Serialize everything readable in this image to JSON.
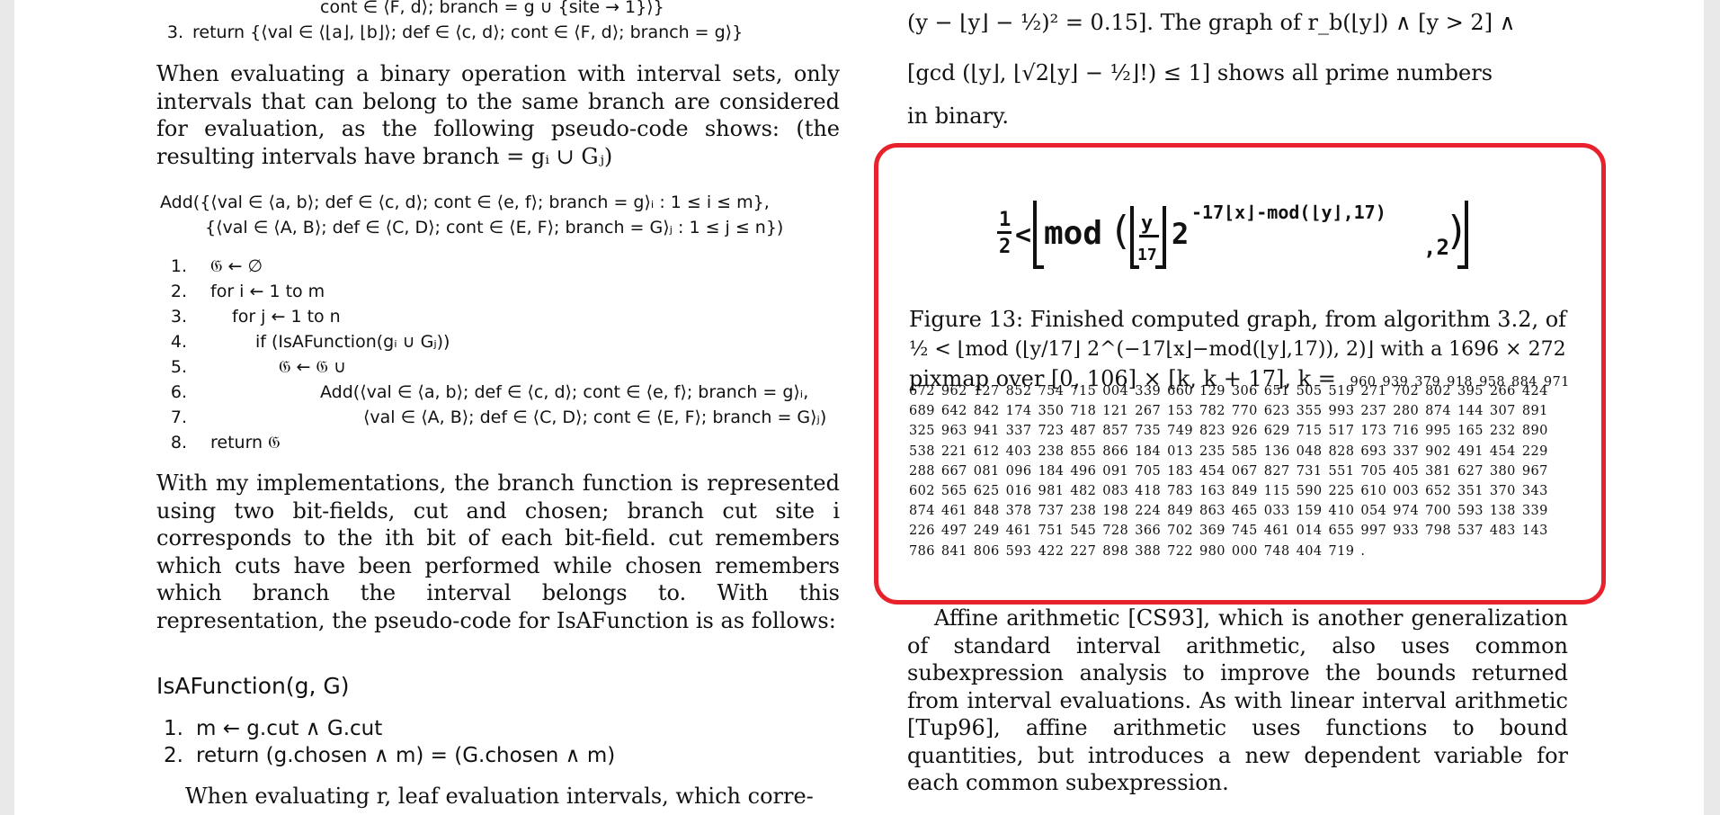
{
  "left": {
    "top_algo": {
      "line_prev": "cont ∈ ⟨F, d⟩; branch = g ∪ {site → 1}⟩}",
      "line3_num": "3.",
      "line3": "return {⟨val ∈ ⟨⌊a⌋, ⌊b⌋⟩; def ∈ ⟨c, d⟩; cont ∈ ⟨F, d⟩; branch = g⟩}"
    },
    "para1": "When evaluating a binary operation with interval sets, only intervals that can belong to the same branch are considered for evaluation, as the following pseudo-code shows: (the resulting intervals have branch = gᵢ ∪ Gⱼ)",
    "add_header_1": "Add({⟨val ∈ ⟨a, b⟩; def ∈ ⟨c, d⟩; cont ∈ ⟨e, f⟩; branch = g⟩ᵢ : 1 ≤ i ≤ m},",
    "add_header_2": "{⟨val ∈ ⟨A, B⟩; def ∈ ⟨C, D⟩; cont ∈ ⟨E, F⟩; branch = G⟩ⱼ : 1 ≤ j ≤ n})",
    "add_lines": [
      {
        "num": "1.",
        "text": "𝔊 ← ∅"
      },
      {
        "num": "2.",
        "text": "for i ← 1 to m"
      },
      {
        "num": "3.",
        "text": "for j ← 1 to n"
      },
      {
        "num": "4.",
        "text": "if (IsAFunction(gᵢ ∪ Gⱼ))"
      },
      {
        "num": "5.",
        "text": "𝔊 ← 𝔊 ∪"
      },
      {
        "num": "6.",
        "text": "Add(⟨val ∈ ⟨a, b⟩; def ∈ ⟨c, d⟩; cont ∈ ⟨e, f⟩; branch = g⟩ᵢ,"
      },
      {
        "num": "7.",
        "text": "⟨val ∈ ⟨A, B⟩; def ∈ ⟨C, D⟩; cont ∈ ⟨E, F⟩; branch = G⟩ⱼ)"
      },
      {
        "num": "8.",
        "text": "return 𝔊"
      }
    ],
    "para2": "With my implementations, the branch function is represented using two bit-fields, cut and chosen; branch cut site i corresponds to the ith bit of each bit-field. cut remembers which cuts have been performed while chosen remembers which branch the interval belongs to. With this representation, the pseudo-code for IsAFunction is as follows:",
    "isa_heading": "IsAFunction(g, G)",
    "isa_lines": [
      {
        "num": "1.",
        "text": "m ← g.cut ∧ G.cut"
      },
      {
        "num": "2.",
        "text": "return (g.chosen ∧ m) = (G.chosen ∧ m)"
      }
    ],
    "para3": "When evaluating r, leaf evaluation intervals, which corre-"
  },
  "right": {
    "top_line1": "(y − ⌊y⌋ − ½)² = 0.15].  The graph of r_b(⌊y⌋) ∧ [y > 2] ∧",
    "top_line2": "[gcd (⌊y⌋, ⌊√2⌊y⌋ − ½⌋!) ≤ 1] shows all prime numbers",
    "top_line3": "in binary.",
    "figure": {
      "caption_line1": "Figure 13: Finished computed graph, from algorithm 3.2, of",
      "caption_line2": "½ < ⌊mod (⌊y/17⌋ 2^(−17⌊x⌋−mod(⌊y⌋,17)), 2)⌋ with a 1696 × 272",
      "caption_line3_text": "pixmap over [0, 106] × [k, k + 17], k =",
      "digits_first": "960 939 379 918 958 884 971",
      "digits": "672 962 127 852 754 715 004 339 660 129 306 651 505 519 271 702 802 395 266 424 689 642 842 174 350 718 121 267 153 782 770 623 355 993 237 280 874 144 307 891 325 963 941 337 723 487 857 735 749 823 926 629 715 517 173 716 995 165 232 890 538 221 612 403 238 855 866 184 013 235 585 136 048 828 693 337 902 491 454 229 288 667 081 096 184 496 091 705 183 454 067 827 731 551 705 405 381 627 380 967 602 565 625 016 981 482 083 418 783 163 849 115 590 225 610 003 652 351 370 343 874 461 848 378 737 238 198 224 849 863 465 033 159 410 054 974 700 593 138 339 226 497 249 461 751 545 728 366 702 369 745 461 014 655 997 933 798 537 483 143 786 841 806 593 422 227 898 388 722 980 000 748 404 719 .",
      "pixel_text": {
        "half_top": "1",
        "half_bottom": "2",
        "lt": "<",
        "mod": "mod",
        "y": "y",
        "n17": "17",
        "two": "2",
        "exp": "-17⌊x⌋-mod(⌊y⌋,17)",
        "comma_two": ",2"
      }
    },
    "para_after": "Affine arithmetic [CS93], which is another generalization of standard interval arithmetic, also uses common subexpression analysis to improve the bounds returned from interval evaluations. As with linear interval arithmetic [Tup96], affine arithmetic uses functions to bound quantities, but introduces a new dependent variable for each common subexpression."
  },
  "colors": {
    "highlight_border": "#e8222c",
    "page_background": "#ffffff",
    "margin_background": "#e9e9e9"
  }
}
